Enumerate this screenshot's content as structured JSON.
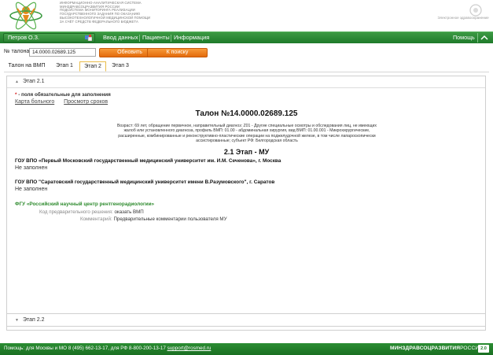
{
  "header": {
    "org_lines": [
      "Информационно-аналитическая система",
      "Минздравсоцразвития России",
      "Подсистема мониторинга реализации",
      "государственного задания по оказанию",
      "высокотехнологичной медицинской помощи",
      "за счёт средств федерального бюджета"
    ],
    "ehealth_text": "Электронное здравоохранение"
  },
  "topnav": {
    "user_label": "Петров О.З.",
    "links": [
      "Ввод данных",
      "Пациенты",
      "Информация"
    ],
    "help_label": "Помощь"
  },
  "talon_bar": {
    "label": "№ талона:",
    "input_value": "14.0000.02689.125",
    "refresh_button": "Обновить",
    "search_button": "К поиску"
  },
  "tabs": [
    "Талон на ВМП",
    "Этап 1",
    "Этап 2",
    "Этап 3"
  ],
  "active_tab": "Этап 2",
  "section": {
    "header": "Этап 2.1",
    "required_star": "*",
    "required_note": " - поля обязательные для заполнения",
    "link_card": "Карта больного",
    "link_terms": "Просмотр сроков",
    "title": "Талон №14.0000.02689.125",
    "patient_info": "Возраст: 69 лет, обращение первичное, направительный диагноз: Z01 - Другие специальные осмотры и обследования лиц, не имеющих жалоб или установленного диагноза, профиль ВМП: 01.00 - абдоминальная хирургия, вид ВМП: 01.00.001 - Микрохирургические, расширенные, комбинированные и реконструктивно-пластические операции на поджелудочной железе, в том числе лапароскопически ассистированные; субъект РФ: Белгородская область",
    "stage_title": "2.1 Этап - МУ",
    "org1_name": "ГОУ ВПО «Первый Московский государственный медицинский университет им. И.М. Сеченова», г. Москва",
    "org1_status": "Не заполнен",
    "org2_name": "ГОУ ВПО \"Саратовский государственный медицинский университет имени В.Разумовского\", г. Саратов",
    "org2_status": "Не заполнен",
    "fgu_name": "ФГУ «Российский научный центр рентгенорадиологии»",
    "decision_label": "Код предварительного решения:",
    "decision_value": "оказать ВМП",
    "comment_label": "Комментарий:",
    "comment_value": "Предварительные комментарии пользователя МУ"
  },
  "section2": {
    "header": "Этап 2.2"
  },
  "footer": {
    "help_text": "Помощь: для Москвы и МО 8 (495) 662-13-17, для РФ 8-800-200-13-17",
    "email": "support@rosmed.ru",
    "ministry_bold": "МИНЗДРАВСОЦРАЗВИТИЯ",
    "ministry_thin": "РОССИИ",
    "version": "2.0"
  },
  "colors": {
    "nav_green": "#2a8433",
    "accent_orange": "#e36b0c",
    "required_red": "#d31d1d",
    "fgu_green": "#2e8b2e"
  }
}
